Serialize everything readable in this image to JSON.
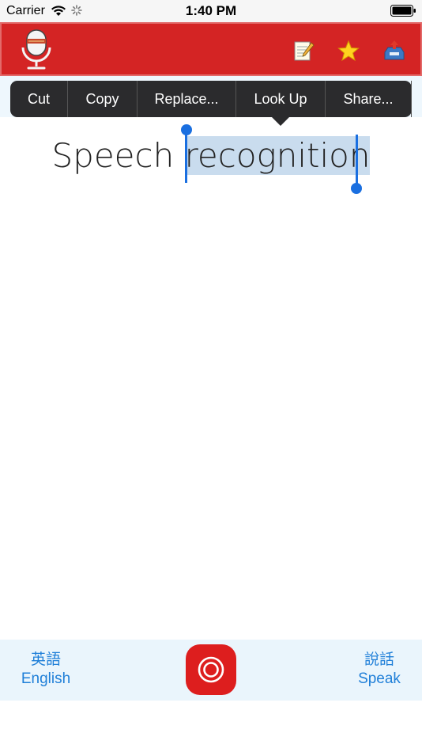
{
  "status_bar": {
    "carrier": "Carrier",
    "time": "1:40 PM"
  },
  "toolbar": {
    "icons": [
      "microphone-icon",
      "edit-note-icon",
      "star-icon",
      "inbox-upload-icon"
    ],
    "background_color": "#d42424"
  },
  "context_menu": {
    "items": [
      "Cut",
      "Copy",
      "Replace...",
      "Look Up",
      "Share..."
    ]
  },
  "content": {
    "text_before": "Speech ",
    "text_selected": "recognition"
  },
  "bottom_bar": {
    "language_native": "英語",
    "language": "English",
    "speak_native": "說話",
    "speak": "Speak",
    "record_color": "#dd1e1e"
  }
}
